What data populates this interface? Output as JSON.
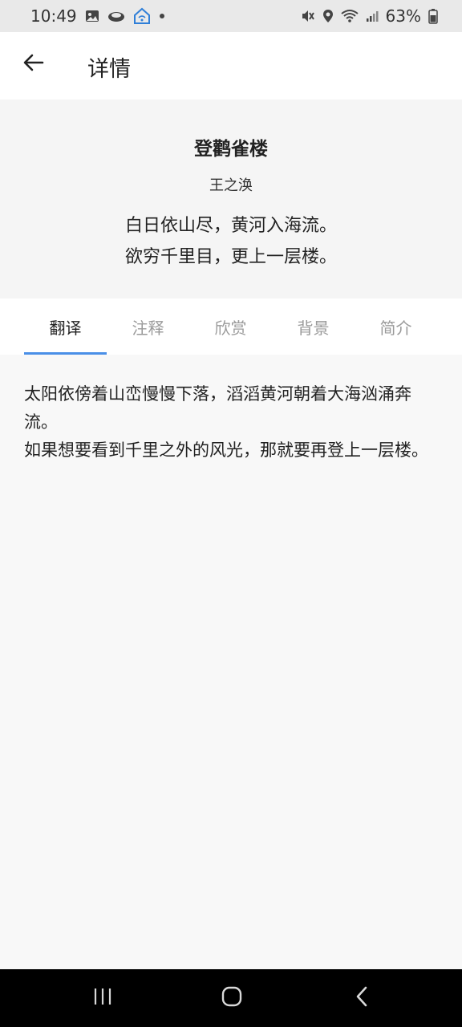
{
  "status_bar": {
    "time": "10:49",
    "battery": "63%",
    "icons": [
      "gallery-icon",
      "cloud-icon",
      "home-wifi-icon",
      "dot-icon",
      "mute-icon",
      "location-icon",
      "wifi-icon",
      "signal-icon",
      "battery-icon"
    ]
  },
  "app_bar": {
    "back_icon": "arrow-left-icon",
    "title": "详情"
  },
  "poem": {
    "title": "登鹳雀楼",
    "author": "王之涣",
    "lines": [
      "白日依山尽，黄河入海流。",
      "欲穷千里目，更上一层楼。"
    ]
  },
  "tabs": [
    {
      "label": "翻译",
      "active": true
    },
    {
      "label": "注释",
      "active": false
    },
    {
      "label": "欣赏",
      "active": false
    },
    {
      "label": "背景",
      "active": false
    },
    {
      "label": "简介",
      "active": false
    }
  ],
  "content": {
    "paragraphs": [
      "太阳依傍着山峦慢慢下落，滔滔黄河朝着大海汹涌奔流。",
      "如果想要看到千里之外的风光，那就要再登上一层楼。"
    ]
  },
  "colors": {
    "accent": "#4a8fe7",
    "tab_inactive": "#9a9a9a",
    "status_bar_bg": "#e9e9e9",
    "nav_bar_bg": "#000000"
  },
  "nav_bar": {
    "icons": [
      "recent-apps-icon",
      "home-icon",
      "back-nav-icon"
    ]
  }
}
